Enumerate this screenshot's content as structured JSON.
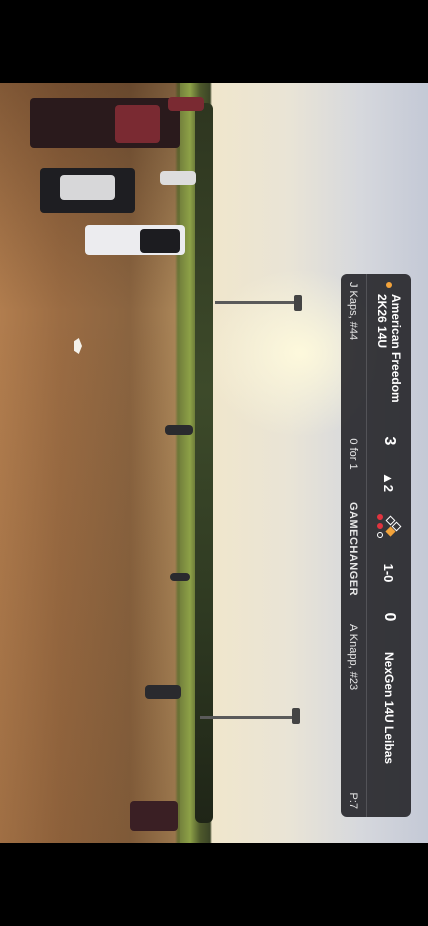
{
  "scoreboard": {
    "home_team": "American Freedom 2K26 14U",
    "home_score": "3",
    "inning": "▲2",
    "count": "1-0",
    "away_score": "0",
    "away_team": "NexGen 14U Leibas",
    "batter": "J Kaps, #44",
    "batter_stat": "0 for 1",
    "brand": "GAMECHANGER",
    "pitcher": "A Knapp, #23",
    "pitch_count": "P:7",
    "bases": {
      "first": true,
      "second": false,
      "third": false
    },
    "outs": 2,
    "colors": {
      "batting_dot": "#f3a33a",
      "base_on": "#f3a33a",
      "out_on": "#e0343f"
    }
  }
}
